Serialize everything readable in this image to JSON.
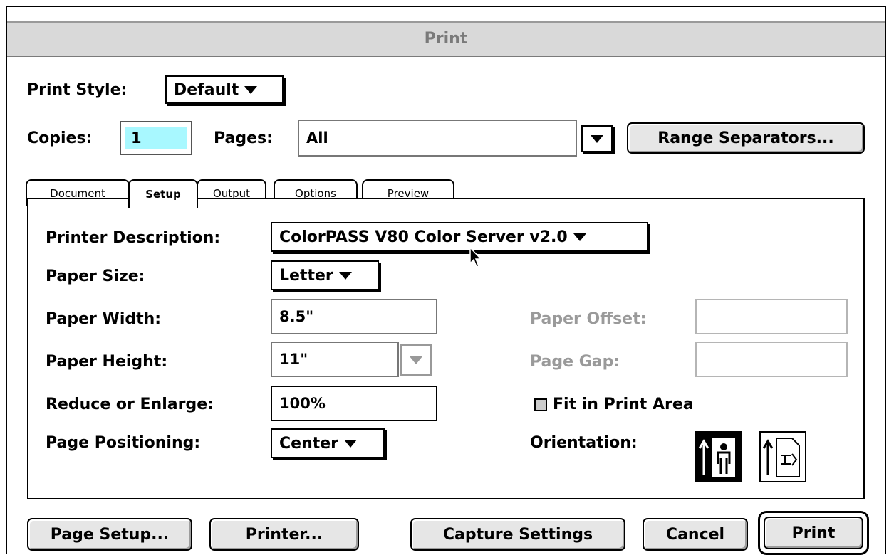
{
  "window": {
    "title": "Print"
  },
  "print_style": {
    "label": "Print Style:",
    "value": "Default"
  },
  "copies": {
    "label": "Copies:",
    "value": "1"
  },
  "pages": {
    "label": "Pages:",
    "value": "All"
  },
  "range_separators_label": "Range Separators...",
  "tabs": [
    {
      "label": "Document"
    },
    {
      "label": "Setup"
    },
    {
      "label": "Output"
    },
    {
      "label": "Options"
    },
    {
      "label": "Preview"
    }
  ],
  "setup": {
    "printer_description": {
      "label": "Printer Description:",
      "value": "ColorPASS V80 Color Server v2.0"
    },
    "paper_size": {
      "label": "Paper Size:",
      "value": "Letter"
    },
    "paper_width": {
      "label": "Paper Width:",
      "value": "8.5\""
    },
    "paper_height": {
      "label": "Paper Height:",
      "value": "11\""
    },
    "reduce_enlarge": {
      "label": "Reduce or Enlarge:",
      "value": "100%"
    },
    "page_positioning": {
      "label": "Page Positioning:",
      "value": "Center"
    },
    "paper_offset": {
      "label": "Paper Offset:",
      "value": ""
    },
    "page_gap": {
      "label": "Page Gap:",
      "value": ""
    },
    "fit_in_print_area": {
      "label": "Fit in Print Area",
      "checked": false
    },
    "orientation": {
      "label": "Orientation:",
      "selected": "portrait"
    }
  },
  "buttons": {
    "page_setup": "Page Setup...",
    "printer": "Printer...",
    "capture_settings": "Capture Settings",
    "cancel": "Cancel",
    "print": "Print"
  },
  "colors": {
    "copies_field_bg": "#a8f8ff",
    "titlebar_bg": "#d9d9d9",
    "disabled_text": "#9a9a9a"
  }
}
